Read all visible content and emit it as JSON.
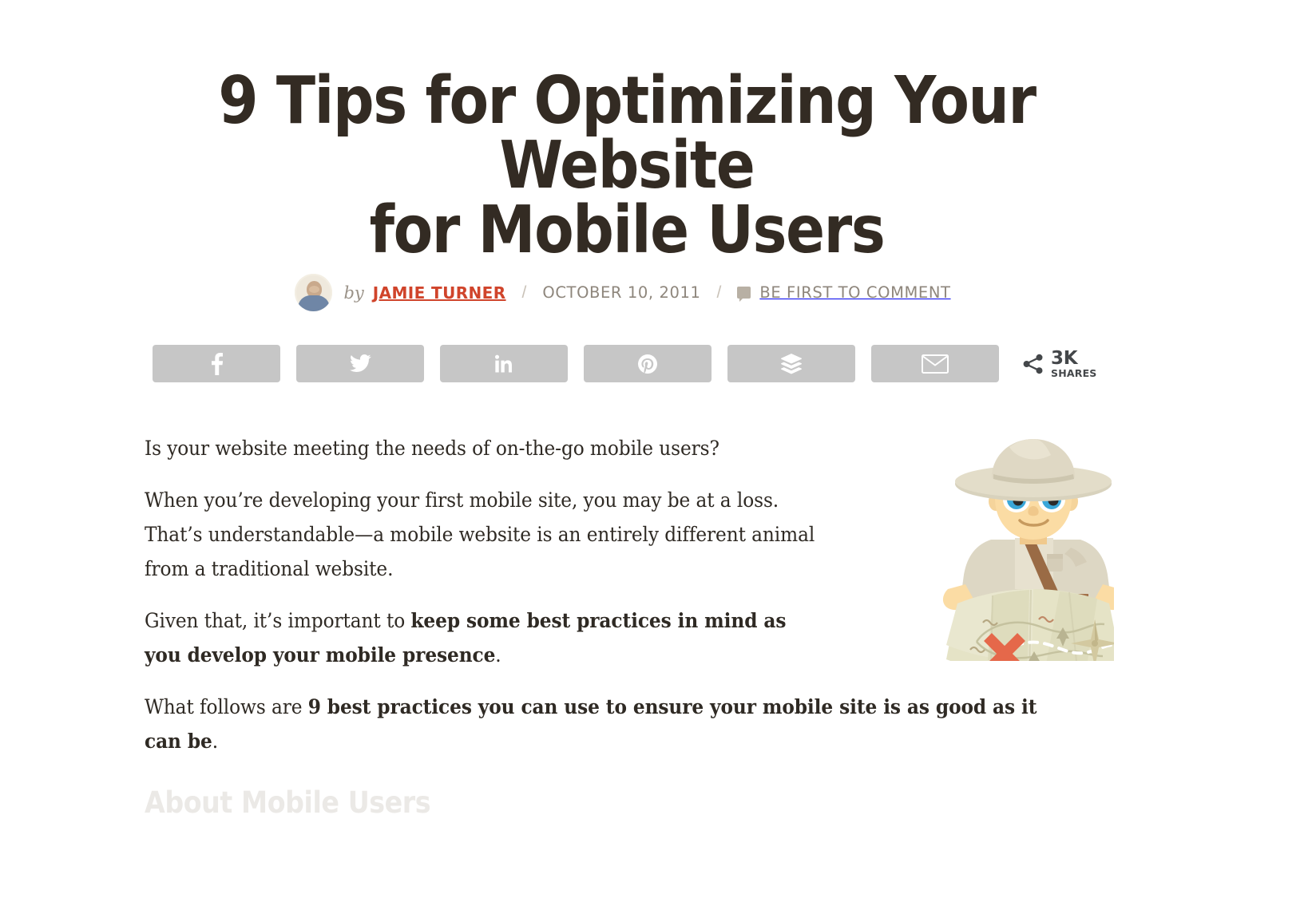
{
  "article": {
    "title_line_1": "9 Tips for Optimizing Your Website",
    "title_line_2": "for Mobile Users",
    "title_color": "#332b23"
  },
  "byline": {
    "by_label": "by",
    "author_name": "JAMIE TURNER",
    "author_color": "#d0442b",
    "separator": "/",
    "date": "OCTOBER 10, 2011",
    "comment_label": "BE FIRST TO COMMENT",
    "comment_icon": "speech-bubble-icon",
    "avatar_icon": "author-avatar"
  },
  "share": {
    "buttons": [
      {
        "network": "Facebook",
        "icon": "facebook-icon"
      },
      {
        "network": "Twitter",
        "icon": "twitter-icon"
      },
      {
        "network": "LinkedIn",
        "icon": "linkedin-icon"
      },
      {
        "network": "Pinterest",
        "icon": "pinterest-icon"
      },
      {
        "network": "Buffer",
        "icon": "buffer-icon"
      },
      {
        "network": "Email",
        "icon": "email-icon"
      }
    ],
    "button_color": "#c6c6c6",
    "count": "3K",
    "count_label": "SHARES",
    "count_icon": "share-nodes-icon"
  },
  "body": {
    "p1": "Is your website meeting the needs of on-the-go mobile users?",
    "p2": "When you’re developing your first mobile site, you may be at a loss. That’s understandable—a mobile website is an entirely different animal from a traditional website.",
    "p3_lead": "Given that, it’s important to ",
    "p3_bold": "keep some best practices in mind as you develop your mobile presence",
    "p3_tail": ".",
    "p4_lead": "What follows are ",
    "p4_bold": "9 best practices you can use to ensure your mobile site is as good as it can be",
    "p4_tail": ".",
    "heading": "About Mobile Users"
  },
  "illustration": {
    "name": "explorer-with-treasure-map-illustration",
    "alt": "Cartoon explorer wearing a pith helmet holding an open treasure map with a red X and compass rose"
  }
}
